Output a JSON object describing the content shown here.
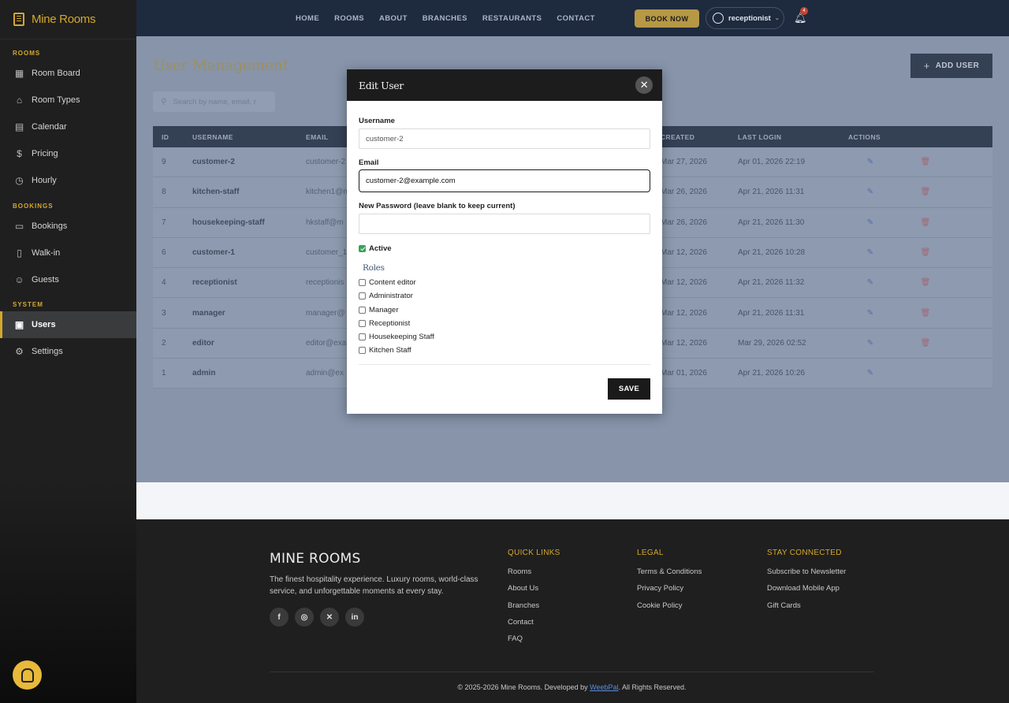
{
  "app": {
    "brand": "Mine Rooms"
  },
  "sidebar": {
    "sections": [
      {
        "title": "ROOMS",
        "items": [
          {
            "label": "Room Board",
            "icon": "grid-icon"
          },
          {
            "label": "Room Types",
            "icon": "home-icon"
          },
          {
            "label": "Calendar",
            "icon": "calendar-icon"
          },
          {
            "label": "Pricing",
            "icon": "dollar-icon"
          },
          {
            "label": "Hourly",
            "icon": "clock-icon"
          }
        ]
      },
      {
        "title": "BOOKINGS",
        "items": [
          {
            "label": "Bookings",
            "icon": "document-icon"
          },
          {
            "label": "Walk-in",
            "icon": "door-icon"
          },
          {
            "label": "Guests",
            "icon": "people-icon"
          }
        ]
      },
      {
        "title": "SYSTEM",
        "items": [
          {
            "label": "Users",
            "icon": "user-badge-icon",
            "active": true
          },
          {
            "label": "Settings",
            "icon": "gear-icon"
          }
        ]
      }
    ]
  },
  "topnav": {
    "links": [
      "HOME",
      "ROOMS",
      "ABOUT",
      "BRANCHES",
      "RESTAURANTS",
      "CONTACT"
    ],
    "book_label": "BOOK NOW",
    "user_label": "receptionist",
    "notifications": "4"
  },
  "page": {
    "title": "User Management",
    "add_label": "ADD USER",
    "search_placeholder": "Search by name, email, r"
  },
  "table": {
    "headers": [
      "ID",
      "USERNAME",
      "EMAIL",
      "CREATED",
      "LAST LOGIN",
      "ACTIONS"
    ],
    "rows": [
      {
        "id": "9",
        "username": "customer-2",
        "email": "customer-2",
        "created": "Mar 27, 2026",
        "last_login": "Apr 01, 2026 22:19"
      },
      {
        "id": "8",
        "username": "kitchen-staff",
        "email": "kitchen1@m",
        "created": "Mar 26, 2026",
        "last_login": "Apr 21, 2026 11:31"
      },
      {
        "id": "7",
        "username": "housekeeping-staff",
        "email": "hkstaff@m",
        "created": "Mar 26, 2026",
        "last_login": "Apr 21, 2026 11:30"
      },
      {
        "id": "6",
        "username": "customer-1",
        "email": "customer_1",
        "created": "Mar 12, 2026",
        "last_login": "Apr 21, 2026 10:28"
      },
      {
        "id": "4",
        "username": "receptionist",
        "email": "receptionis",
        "created": "Mar 12, 2026",
        "last_login": "Apr 21, 2026 11:32"
      },
      {
        "id": "3",
        "username": "manager",
        "email": "manager@",
        "created": "Mar 12, 2026",
        "last_login": "Apr 21, 2026 11:31"
      },
      {
        "id": "2",
        "username": "editor",
        "email": "editor@exa",
        "created": "Mar 12, 2026",
        "last_login": "Mar 29, 2026 02:52"
      },
      {
        "id": "1",
        "username": "admin",
        "email": "admin@ex",
        "created": "Mar 01, 2026",
        "last_login": "Apr 21, 2026 10:26"
      }
    ]
  },
  "modal": {
    "title": "Edit User",
    "username_label": "Username",
    "username_value": "customer-2",
    "email_label": "Email",
    "email_value": "customer-2@example.com",
    "password_label": "New Password (leave blank to keep current)",
    "password_value": "",
    "active_label": "Active",
    "active_checked": true,
    "roles_heading": "Roles",
    "roles": [
      {
        "label": "Content editor",
        "checked": false
      },
      {
        "label": "Administrator",
        "checked": false
      },
      {
        "label": "Manager",
        "checked": false
      },
      {
        "label": "Receptionist",
        "checked": false
      },
      {
        "label": "Housekeeping Staff",
        "checked": false
      },
      {
        "label": "Kitchen Staff",
        "checked": false
      }
    ],
    "save_label": "SAVE"
  },
  "footer": {
    "brand": "MINE ROOMS",
    "description": "The finest hospitality experience. Luxury rooms, world-class service, and unforgettable moments at every stay.",
    "social": [
      "facebook-icon",
      "instagram-icon",
      "x-icon",
      "linkedin-icon"
    ],
    "columns": [
      {
        "title": "QUICK LINKS",
        "links": [
          "Rooms",
          "About Us",
          "Branches",
          "Contact",
          "FAQ"
        ]
      },
      {
        "title": "LEGAL",
        "links": [
          "Terms & Conditions",
          "Privacy Policy",
          "Cookie Policy"
        ]
      },
      {
        "title": "STAY CONNECTED",
        "links": [
          "Subscribe to Newsletter",
          "Download Mobile App",
          "Gift Cards"
        ]
      }
    ],
    "copy_before": "© 2025-2026 Mine Rooms. Developed by ",
    "copy_link": "WeebPal",
    "copy_after": ". All Rights Reserved."
  },
  "colors": {
    "accent": "#d4a82c",
    "navy": "#1e2a3e",
    "danger": "#b05d68",
    "success": "#3aa15a"
  }
}
